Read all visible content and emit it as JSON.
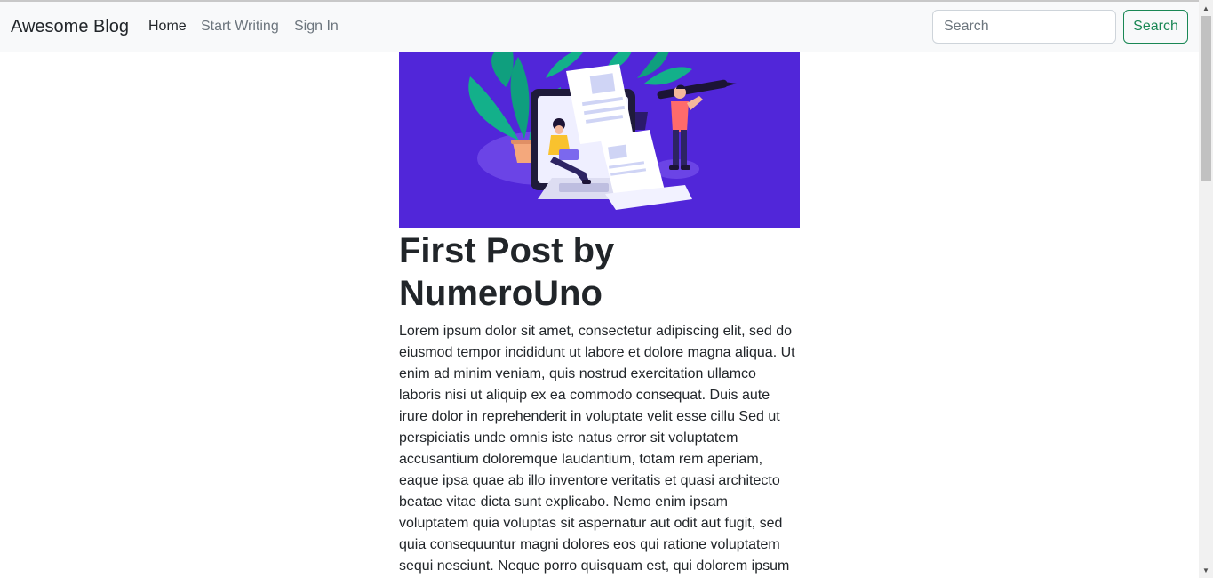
{
  "navbar": {
    "brand": "Awesome Blog",
    "links": [
      "Home",
      "Start Writing",
      "Sign In"
    ],
    "search_placeholder": "Search",
    "search_button": "Search"
  },
  "post": {
    "title": "First Post by NumeroUno",
    "body": "Lorem ipsum dolor sit amet, consectetur adipiscing elit, sed do eiusmod tempor incididunt ut labore et dolore magna aliqua. Ut enim ad minim veniam, quis nostrud exercitation ullamco laboris nisi ut aliquip ex ea commodo consequat. Duis aute irure dolor in reprehenderit in voluptate velit esse cillu Sed ut perspiciatis unde omnis iste natus error sit voluptatem accusantium doloremque laudantium, totam rem aperiam, eaque ipsa quae ab illo inventore veritatis et quasi architecto beatae vitae dicta sunt explicabo. Nemo enim ipsam voluptatem quia voluptas sit aspernatur aut odit aut fugit, sed quia consequuntur magni dolores eos qui ratione voluptatem sequi nesciunt. Neque porro quisquam est, qui dolorem ipsum"
  },
  "colors": {
    "navbar_bg": "#f8f9fa",
    "hero_bg": "#5126d9",
    "search_button": "#198754"
  }
}
